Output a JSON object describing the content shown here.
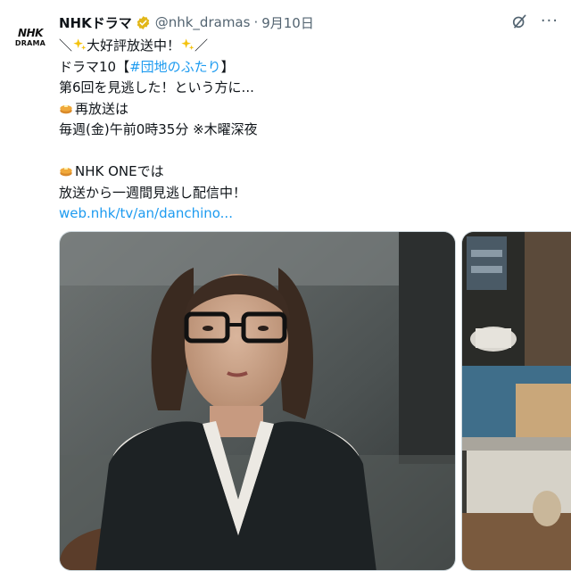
{
  "account": {
    "logo_line1": "NHK",
    "logo_line2": "DRAMA",
    "display_name": "NHKドラマ",
    "handle": "@nhk_dramas",
    "separator": "·",
    "date": "9月10日",
    "verified_icon": "verified-badge-icon",
    "verified_color": "#e2b719"
  },
  "header_icons": {
    "grok": "grok-icon",
    "more": "more-icon",
    "more_glyph": "···"
  },
  "tweet": {
    "line1_prefix": "＼",
    "line1_text": "大好評放送中！",
    "line1_suffix": "／",
    "line2_prefix": "ドラマ10【",
    "line2_hashtag": "#団地のふたり",
    "line2_suffix": "】",
    "line3": "第6回を見逃した！という方に...",
    "line4": "再放送は",
    "line5": "毎週(金)午前0時35分 ※木曜深夜",
    "line6": "NHK ONEでは",
    "line7": "放送から一週間見逃し配信中！",
    "link": "web.nhk/tv/an/danchino..."
  },
  "colors": {
    "link": "#1d9bf0",
    "text": "#0f1419",
    "muted": "#536471"
  },
  "media": {
    "photo1": "drama-still-woman-with-glasses",
    "photo2": "drama-still-kitchen"
  }
}
